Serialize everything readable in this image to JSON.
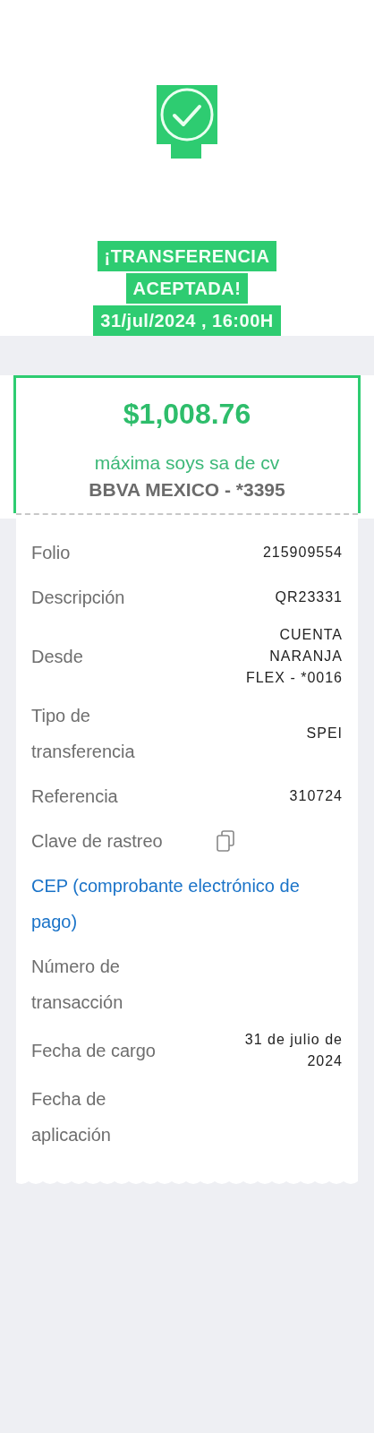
{
  "header": {
    "title_lines": [
      "¡TRANSFERENCIA",
      "ACEPTADA!",
      "31/jul/2024 , 16:00H"
    ]
  },
  "summary": {
    "amount": "$1,008.76",
    "recipient": "máxima soys sa de cv",
    "bank": "BBVA MEXICO - *3395"
  },
  "details": [
    {
      "kind": "pair",
      "label": "Folio",
      "value": "215909554"
    },
    {
      "kind": "pair",
      "label": "Descripción",
      "value": "QR23331"
    },
    {
      "kind": "pair",
      "label": "Desde",
      "value": "CUENTA NARANJA FLEX - *0016"
    },
    {
      "kind": "pair",
      "label": "Tipo de transferencia",
      "value": "SPEI"
    },
    {
      "kind": "pair",
      "label": "Referencia",
      "value": "310724"
    },
    {
      "kind": "copy",
      "label": "Clave de rastreo"
    },
    {
      "kind": "link",
      "label": "CEP (comprobante electrónico de pago)"
    },
    {
      "kind": "pair",
      "label": "Número de transacción"
    },
    {
      "kind": "pair",
      "label": "Fecha de cargo",
      "value": "31 de julio de 2024"
    },
    {
      "kind": "pair",
      "label": "Fecha de aplicación"
    }
  ]
}
